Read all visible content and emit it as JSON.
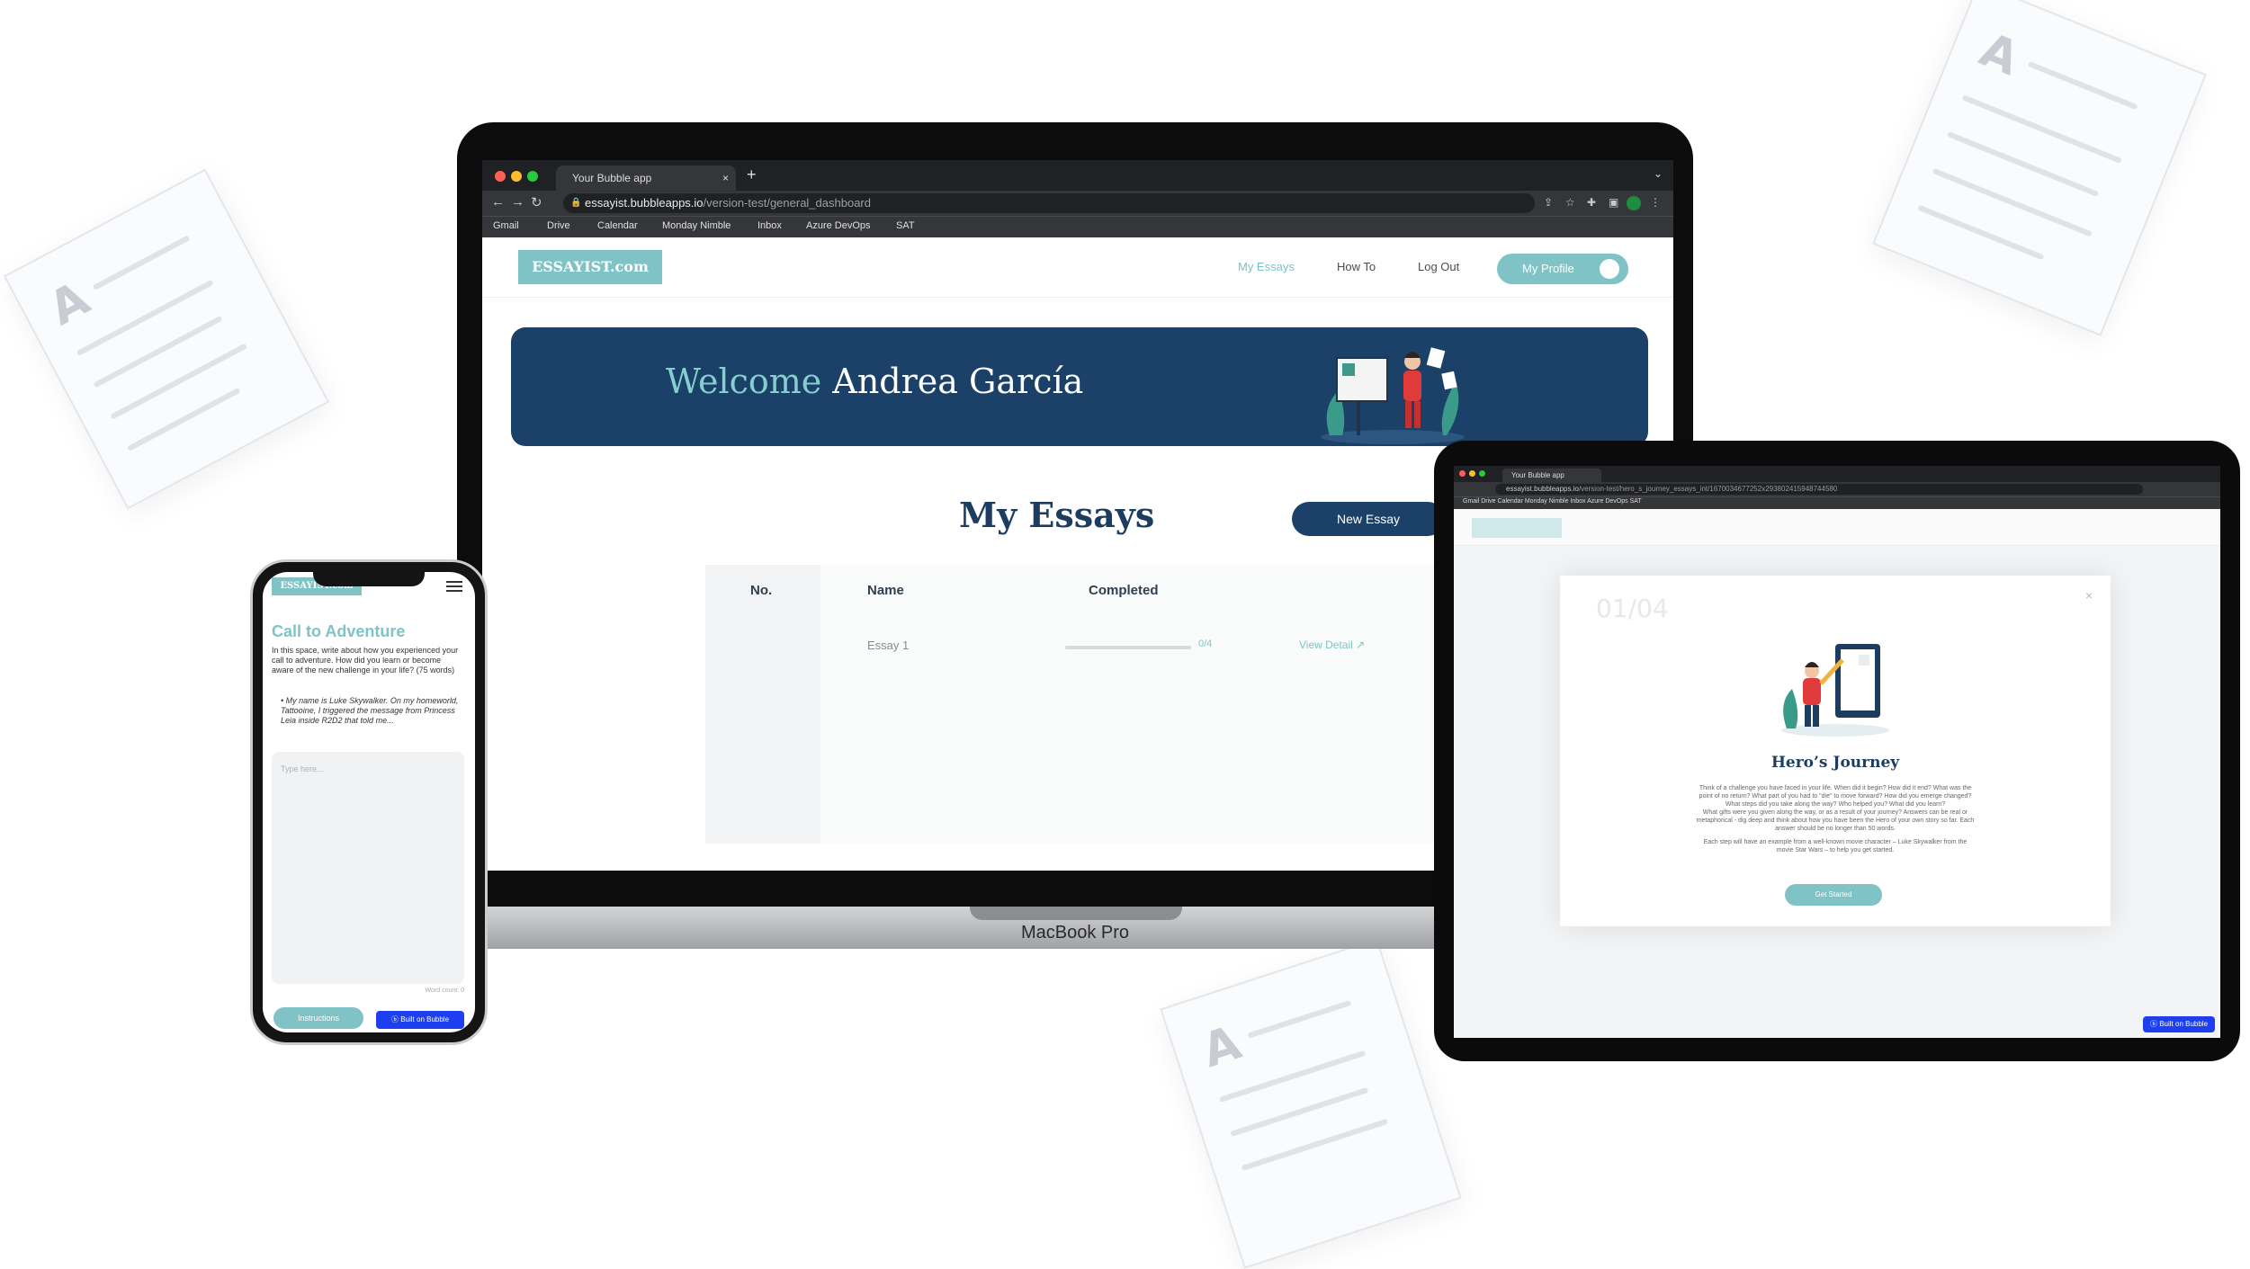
{
  "laptop": {
    "model_label": "MacBook Pro",
    "browser": {
      "tab_title": "Your Bubble app",
      "url_host": "essayist.bubbleapps.io",
      "url_path": "/version-test/general_dashboard",
      "bookmarks": [
        "Gmail",
        "Drive",
        "Calendar",
        "Monday Nimble",
        "Inbox",
        "Azure DevOps",
        "SAT"
      ]
    },
    "site": {
      "logo": "ESSAYIST.com",
      "nav": [
        "My Essays",
        "How To",
        "Log Out"
      ],
      "profile_button": "My Profile",
      "welcome_prefix": "Welcome",
      "welcome_name": "Andrea García",
      "section_title": "My Essays",
      "new_essay_button": "New Essay",
      "table_headers": [
        "No.",
        "Name",
        "Completed"
      ],
      "rows": [
        {
          "name": "Essay 1",
          "progress_label": "0/4",
          "progress_fraction": 0.0,
          "action": "View Detail"
        }
      ]
    }
  },
  "tablet": {
    "browser": {
      "tab_title": "Your Bubble app",
      "url_host": "essayist.bubbleapps.io",
      "url_path": "/version-test/hero_s_journey_essays_int/1670034677252x293802415948744580",
      "bookmarks": "Gmail   Drive   Calendar   Monday Nimble   Inbox   Azure DevOps   SAT"
    },
    "modal": {
      "step": "01/04",
      "close": "×",
      "title": "Hero’s Journey",
      "body_1": "Think of a challenge you have faced in your life. When did it begin? How did it end? What was the point of no return? What part of you had to \"die\" to move forward? How did you emerge changed? What steps did you take along the way? Who helped you? What did you learn?",
      "body_2": "What gifts were you given along the way, or as a result of your journey? Answers can be real or metaphorical - dig deep and think about how you have been the Hero of your own story so far. Each answer should be no longer than 50 words.",
      "body_3": "Each step will have an example from a well-known movie character – Luke Skywalker from the movie Star Wars – to help you get started.",
      "button": "Get Started"
    },
    "badge": "Built on Bubble"
  },
  "phone": {
    "logo": "ESSAYIST.com",
    "title": "Call to Adventure",
    "text": "In this space, write about how you experienced your call to adventure. How did you learn or become aware of the new challenge in your life? (75 words)",
    "example": "My name is Luke Skywalker. On my homeworld, Tattooine, I triggered the message from Princess Leia inside R2D2 that told me...",
    "placeholder": "Type here...",
    "word_count": "Word count: 0",
    "instructions_button": "Instructions",
    "badge": "Built on Bubble"
  },
  "colors": {
    "brand_teal": "#7fc3c6",
    "brand_navy": "#1c4168",
    "bubble_blue": "#1e3ff0"
  }
}
